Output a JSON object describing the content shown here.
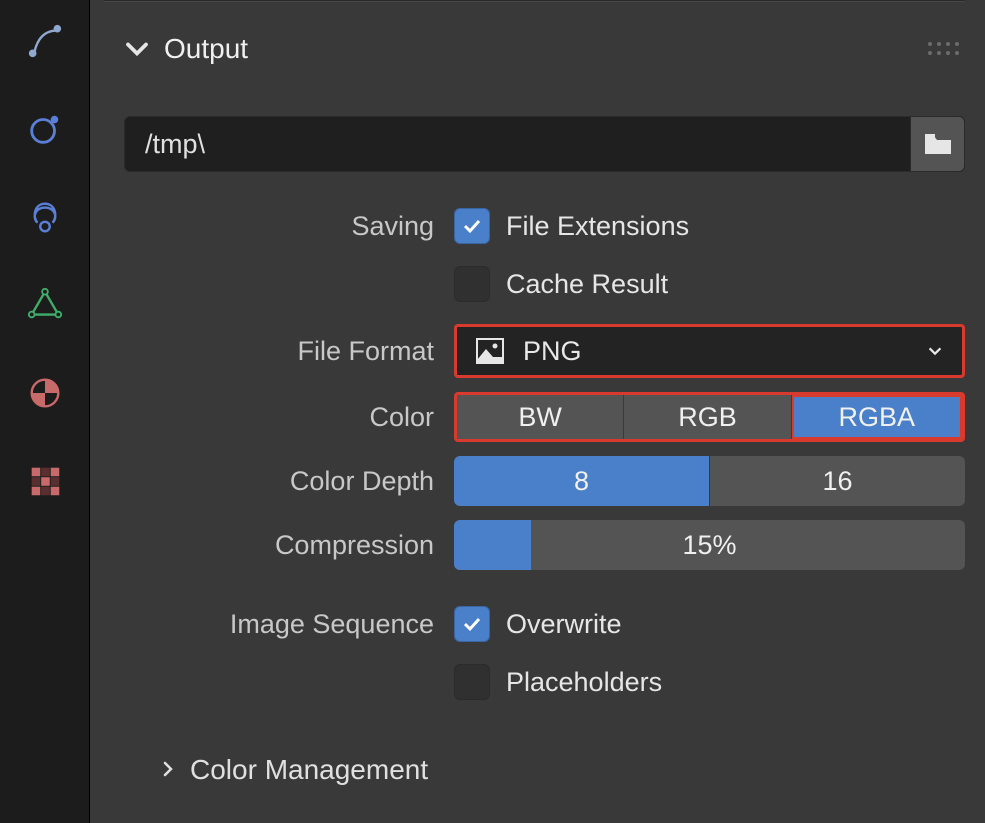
{
  "panel": {
    "title": "Output",
    "path_value": "/tmp\\",
    "saving_label": "Saving",
    "file_extensions_label": "File Extensions",
    "file_extensions_checked": true,
    "cache_result_label": "Cache Result",
    "cache_result_checked": false,
    "file_format_label": "File Format",
    "file_format_value": "PNG",
    "color_label": "Color",
    "color_options": [
      "BW",
      "RGB",
      "RGBA"
    ],
    "color_selected": "RGBA",
    "color_depth_label": "Color Depth",
    "color_depth_options": [
      "8",
      "16"
    ],
    "color_depth_selected": "8",
    "compression_label": "Compression",
    "compression_value": 15,
    "compression_text": "15%",
    "image_sequence_label": "Image Sequence",
    "overwrite_label": "Overwrite",
    "overwrite_checked": true,
    "placeholders_label": "Placeholders",
    "placeholders_checked": false,
    "color_management_label": "Color Management"
  },
  "sidebar_icons": [
    "curve-icon",
    "particles-icon",
    "constraint-icon",
    "modifier-icon",
    "physics-icon",
    "texture-icon"
  ]
}
